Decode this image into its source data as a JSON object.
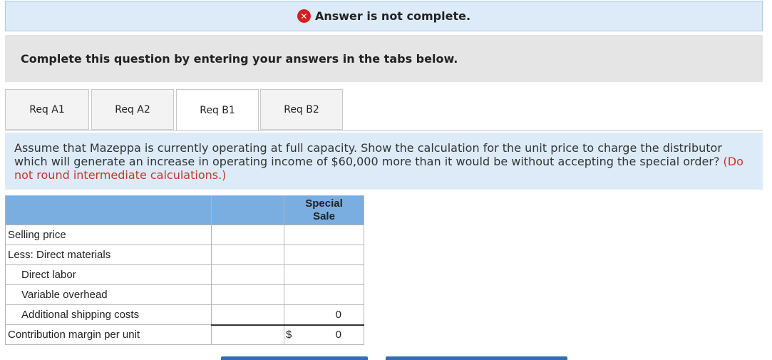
{
  "banner": {
    "icon": "x-circle-icon",
    "text": "Answer is not complete."
  },
  "instruction": "Complete this question by entering your answers in the tabs below.",
  "tabs": [
    {
      "label": "Req A1"
    },
    {
      "label": "Req A2"
    },
    {
      "label": "Req B1"
    },
    {
      "label": "Req B2"
    }
  ],
  "question": {
    "text": "Assume that Mazeppa is currently operating at full capacity. Show the calculation for the unit price to charge the distributor which will generate an increase in operating income of $60,000 more than it would be without accepting the special order?",
    "note": "(Do not round intermediate calculations.)"
  },
  "table": {
    "header": "Special Sale",
    "rows": [
      {
        "label": "Selling price",
        "value": ""
      },
      {
        "label": "Less: Direct materials",
        "value": ""
      },
      {
        "label": "Direct labor",
        "value": ""
      },
      {
        "label": "Variable overhead",
        "value": ""
      },
      {
        "label": "Additional shipping costs",
        "value": "0"
      },
      {
        "label": "Contribution margin per unit",
        "currency": "$",
        "value": "0"
      }
    ]
  },
  "colors": {
    "banner_bg": "#dcebf7",
    "header_bg": "#7aaee0",
    "error_red": "#d32020",
    "note_red": "#c0392b"
  }
}
